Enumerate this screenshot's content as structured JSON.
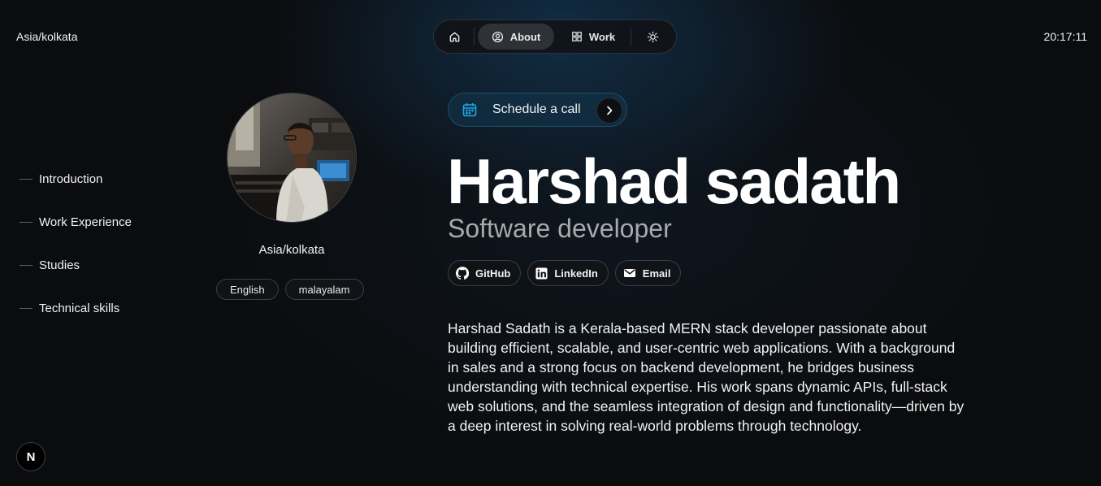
{
  "header": {
    "timezone": "Asia/kolkata",
    "clock": "20:17:11"
  },
  "topnav": {
    "home_icon": "home-icon",
    "about_label": "About",
    "about_icon": "user-circle-icon",
    "work_label": "Work",
    "work_icon": "grid-icon",
    "theme_icon": "sun-icon",
    "active": "About"
  },
  "sidebar": {
    "items": [
      {
        "label": "Introduction"
      },
      {
        "label": "Work Experience"
      },
      {
        "label": "Studies"
      },
      {
        "label": "Technical skills"
      }
    ]
  },
  "profile": {
    "location": "Asia/kolkata",
    "languages": [
      "English",
      "malayalam"
    ]
  },
  "schedule": {
    "label": "Schedule a call",
    "icon": "calendar-icon"
  },
  "hero": {
    "name": "Harshad sadath",
    "role": "Software developer"
  },
  "socials": [
    {
      "label": "GitHub",
      "icon": "github-icon"
    },
    {
      "label": "LinkedIn",
      "icon": "linkedin-icon"
    },
    {
      "label": "Email",
      "icon": "mail-icon"
    }
  ],
  "bio": "Harshad Sadath is a Kerala-based MERN stack developer passionate about building efficient, scalable, and user-centric web applications. With a background in sales and a strong focus on backend development, he bridges business understanding with technical expertise. His work spans dynamic APIs, full-stack web solutions, and the seamless integration of design and functionality—driven by a deep interest in solving real-world problems through technology.",
  "badge": {
    "letter": "N"
  },
  "colors": {
    "background": "#0b0c0e",
    "accent": "#1ea7e6",
    "muted_text": "#a7a9ad"
  }
}
